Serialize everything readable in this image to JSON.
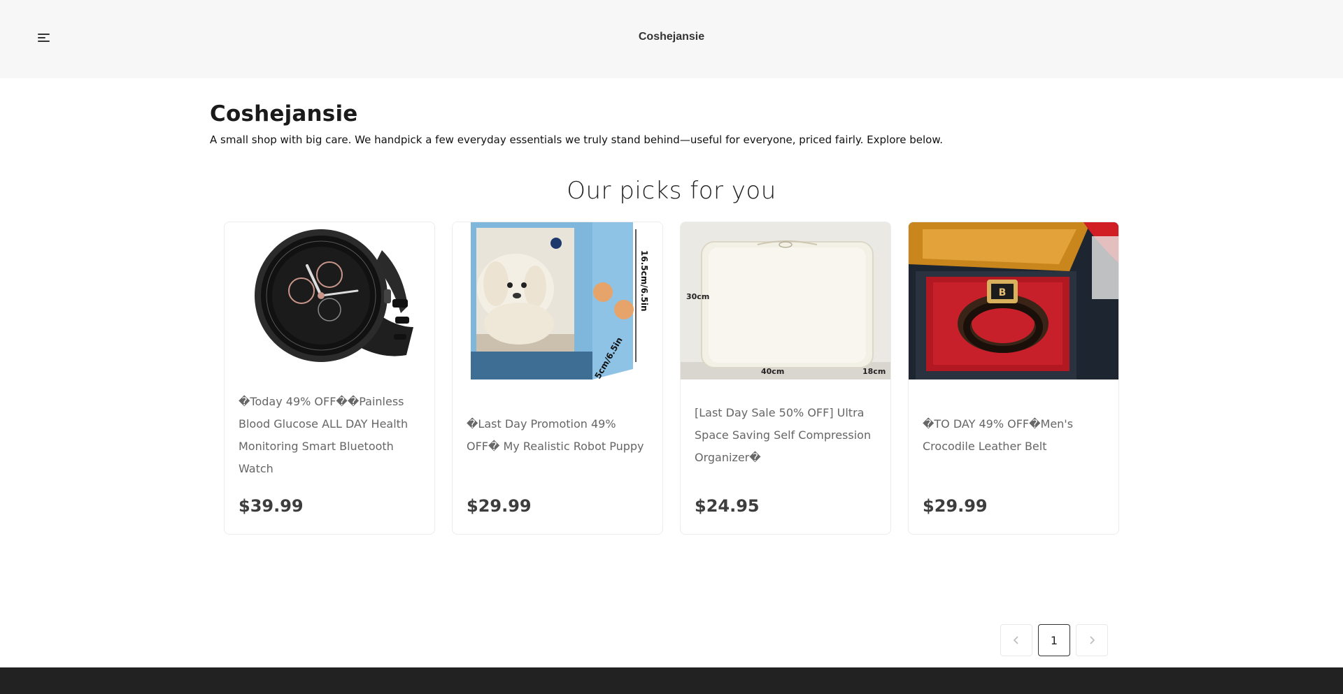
{
  "header": {
    "brand": "Coshejansie",
    "menu_icon": "hamburger-menu-icon"
  },
  "intro": {
    "title": "Coshejansie",
    "description": "A small shop with big care. We handpick a few everyday essentials we truly stand behind—useful for everyone, priced fairly. Explore below."
  },
  "section": {
    "title": "Our picks for you"
  },
  "products": [
    {
      "title": "�Today 49% OFF��Painless Blood Glucose ALL DAY Health Monitoring Smart Bluetooth Watch",
      "price": "$39.99"
    },
    {
      "title": "�Last Day Promotion 49% OFF� My Realistic Robot Puppy",
      "price": "$29.99",
      "image_text": {
        "height": "16.5cm/6.5in",
        "width": "5cm/6.5in"
      }
    },
    {
      "title": "[Last Day Sale 50% OFF] Ultra Space Saving Self Compression Organizer�",
      "price": "$24.95",
      "image_text": {
        "h": "30cm",
        "w": "40cm",
        "d": "18cm"
      }
    },
    {
      "title": "�TO DAY 49% OFF�Men's Crocodile Leather Belt",
      "price": "$29.99"
    }
  ],
  "pagination": {
    "prev_icon": "chevron-left-icon",
    "current_page": "1",
    "next_icon": "chevron-right-icon"
  }
}
